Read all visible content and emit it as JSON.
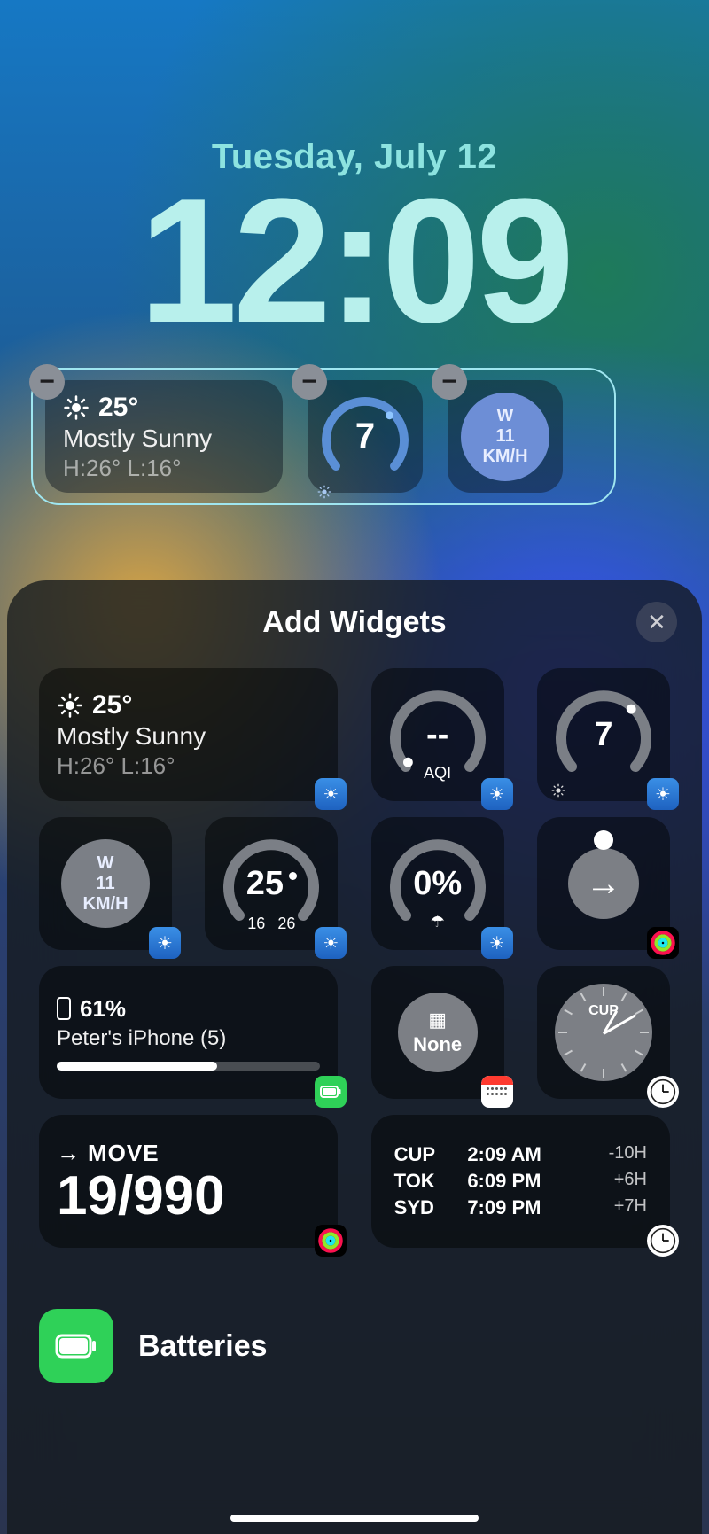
{
  "date": "Tuesday, July 12",
  "time": "12:09",
  "selected_widgets": {
    "weather": {
      "temp": "25°",
      "condition": "Mostly Sunny",
      "hi_lo": "H:26° L:16°"
    },
    "uv": {
      "value": "7"
    },
    "wind": {
      "dir": "W",
      "speed": "11",
      "unit": "KM/H"
    }
  },
  "sheet": {
    "title": "Add Widgets",
    "weather_wide": {
      "temp": "25°",
      "condition": "Mostly Sunny",
      "hi_lo": "H:26° L:16°"
    },
    "aqi": {
      "value": "--",
      "label": "AQI"
    },
    "uv": {
      "value": "7"
    },
    "wind": {
      "dir": "W",
      "speed": "11",
      "unit": "KM/H"
    },
    "temp_gauge": {
      "value": "25",
      "low": "16",
      "high": "26"
    },
    "precip": {
      "value": "0%"
    },
    "battery_wide": {
      "pct": "61%",
      "device": "Peter's iPhone (5)"
    },
    "calendar": {
      "label": "None"
    },
    "clock_city": "CUP",
    "move": {
      "label": "MOVE",
      "value": "19/990"
    },
    "world": [
      {
        "city": "CUP",
        "time": "2:09 AM",
        "offset": "-10H"
      },
      {
        "city": "TOK",
        "time": "6:09 PM",
        "offset": "+6H"
      },
      {
        "city": "SYD",
        "time": "7:09 PM",
        "offset": "+7H"
      }
    ],
    "suggestion_label": "Batteries"
  }
}
